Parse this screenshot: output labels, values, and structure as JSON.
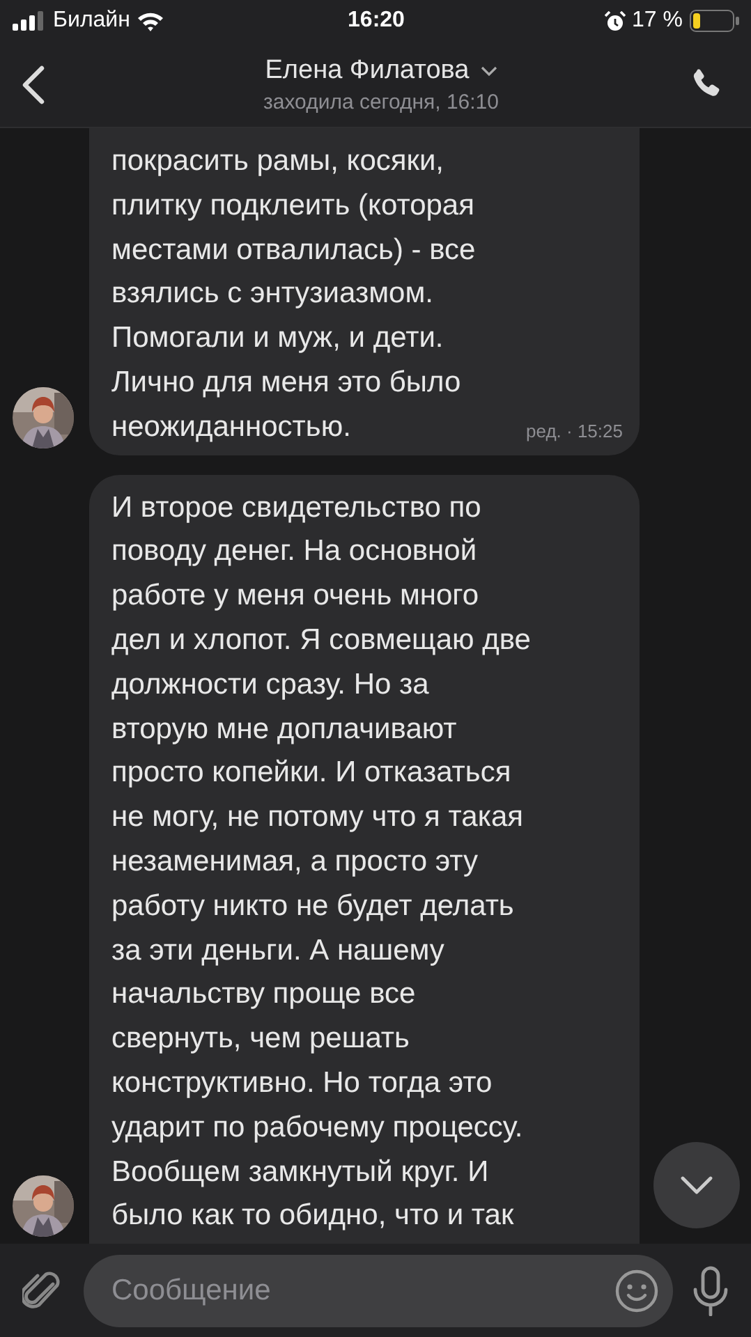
{
  "status_bar": {
    "carrier": "Билайн",
    "time": "16:20",
    "battery": "17 %"
  },
  "header": {
    "name": "Елена Филатова",
    "subtitle": "заходила сегодня, 16:10"
  },
  "messages": [
    {
      "lines": [
        "покрасить рамы, косяки,",
        "плитку подклеить (которая",
        "местами отвалилась) - все",
        "взялись с энтузиазмом.",
        "Помогали и муж, и дети.",
        "Лично для меня это было",
        "неожиданностью."
      ],
      "meta": "ред. · 15:25",
      "cut_top": true,
      "cut_bottom": false
    },
    {
      "lines": [
        "И второе свидетельство по",
        "поводу денег. На основной",
        "работе у меня очень много",
        "дел и хлопот. Я совмещаю две",
        "должности сразу. Но за",
        "вторую мне доплачивают",
        "просто копейки. И отказаться",
        "не могу,  не потому что я такая",
        "незаменимая, а просто эту",
        "работу никто не будет делать",
        "за эти деньги. А нашему",
        "начальству проще все",
        "свернуть, чем решать",
        "конструктивно. Но тогда это",
        "ударит по рабочему процессу.",
        "Вообщем замкнутый круг. И",
        "было как то обидно, что и так"
      ],
      "cut_top": false,
      "cut_bottom": true
    }
  ],
  "composer": {
    "placeholder": "Сообщение"
  }
}
